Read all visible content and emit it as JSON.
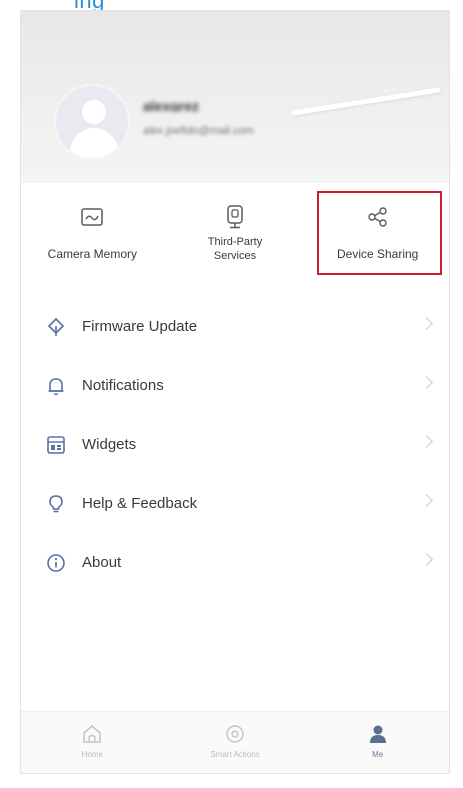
{
  "header_clip_text": "ing",
  "profile": {
    "name": "alexgrez",
    "email": "alex.joefido@mail.com"
  },
  "quick_actions": [
    {
      "label": "Camera Memory",
      "icon": "camera-memory-icon"
    },
    {
      "label": "Third-Party Services",
      "icon": "third-party-icon"
    },
    {
      "label": "Device Sharing",
      "icon": "share-icon",
      "highlighted": true
    }
  ],
  "menu": [
    {
      "label": "Firmware Update",
      "icon": "firmware-icon"
    },
    {
      "label": "Notifications",
      "icon": "bell-icon"
    },
    {
      "label": "Widgets",
      "icon": "widgets-icon"
    },
    {
      "label": "Help & Feedback",
      "icon": "lightbulb-icon"
    },
    {
      "label": "About",
      "icon": "info-icon"
    }
  ],
  "tabs": [
    {
      "label": "Home",
      "icon": "home-icon"
    },
    {
      "label": "Smart Actions",
      "icon": "smart-actions-icon"
    },
    {
      "label": "Me",
      "icon": "profile-icon",
      "active": true
    }
  ],
  "colors": {
    "accent_blue": "#2b8fd6",
    "highlight_red": "#cc1f2e",
    "icon_blue": "#5b6fa8",
    "active_tab": "#5a6f90"
  }
}
